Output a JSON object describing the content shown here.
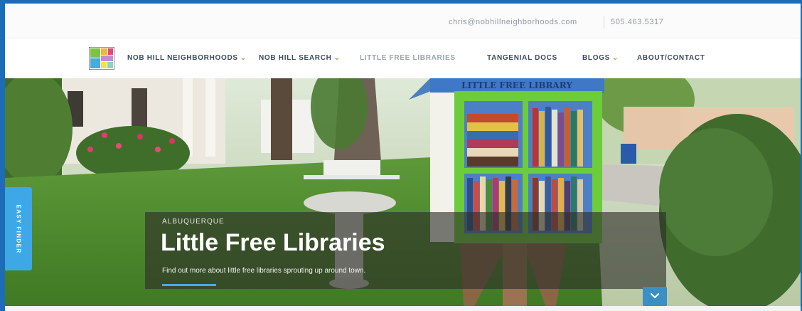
{
  "topbar": {
    "email": "chris@nobhillneighborhoods.com",
    "phone": "505.463.5317"
  },
  "nav": {
    "items": [
      {
        "label": "NOB HILL NEIGHBORHOODS",
        "has_dropdown": true
      },
      {
        "label": "NOB HILL SEARCH",
        "has_dropdown": true
      },
      {
        "label": "LITTLE FREE LIBRARIES",
        "has_dropdown": false,
        "active": true
      },
      {
        "label": "TANGENIAL DOCS",
        "has_dropdown": false
      },
      {
        "label": "BLOGS",
        "has_dropdown": true
      },
      {
        "label": "ABOUT/CONTACT",
        "has_dropdown": false
      }
    ],
    "dropdown_glyph": "⌄"
  },
  "hero": {
    "eyebrow": "ALBUQUERQUE",
    "title": "Little Free Libraries",
    "subtitle": "Find out more about little free libraries sprouting up around town.",
    "sign_text": "LITTLE FREE LIBRARY"
  },
  "easy_finder": {
    "label": "EASY FINDER"
  },
  "colors": {
    "frame": "#1e6bb8",
    "accent_green": "#7cc243",
    "easy_finder_blue": "#3ea7e6",
    "nav_text": "#3b4a5e"
  },
  "icons": {
    "logo": "colored-squares-logo",
    "scroll": "chevron-down-icon"
  }
}
